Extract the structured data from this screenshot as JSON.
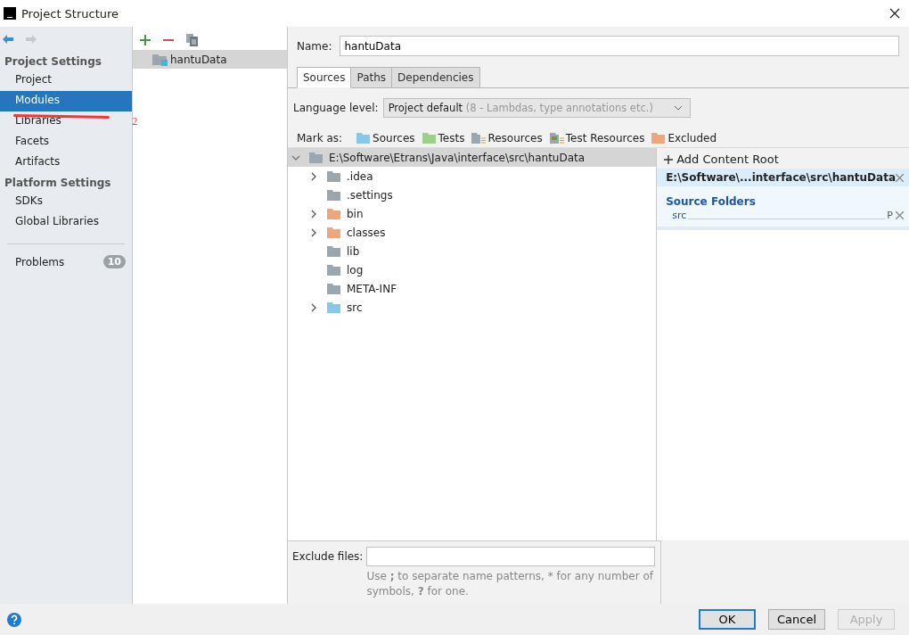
{
  "window": {
    "title": "Project Structure"
  },
  "sidebar": {
    "sections": [
      {
        "title": "Project Settings",
        "items": [
          {
            "label": "Project",
            "selected": false
          },
          {
            "label": "Modules",
            "selected": true
          },
          {
            "label": "Libraries",
            "selected": false
          },
          {
            "label": "Facets",
            "selected": false
          },
          {
            "label": "Artifacts",
            "selected": false
          }
        ]
      },
      {
        "title": "Platform Settings",
        "items": [
          {
            "label": "SDKs",
            "selected": false
          },
          {
            "label": "Global Libraries",
            "selected": false
          }
        ]
      }
    ],
    "problems": {
      "label": "Problems",
      "count": "10"
    }
  },
  "annotation": {
    "mark": "2"
  },
  "modules": [
    {
      "name": "hantuData",
      "selected": true
    }
  ],
  "name_field": {
    "label": "Name:",
    "value": "hantuData"
  },
  "tabs": [
    {
      "label": "Sources",
      "selected": true
    },
    {
      "label": "Paths",
      "selected": false
    },
    {
      "label": "Dependencies",
      "selected": false
    }
  ],
  "language_level": {
    "label": "Language level:",
    "value": "Project default",
    "hint": "(8 - Lambdas, type annotations etc.)"
  },
  "mark_as": {
    "label": "Mark as:",
    "options": [
      {
        "label": "Sources",
        "kind": "sources"
      },
      {
        "label": "Tests",
        "kind": "tests"
      },
      {
        "label": "Resources",
        "kind": "resources"
      },
      {
        "label": "Test Resources",
        "kind": "test-resources"
      },
      {
        "label": "Excluded",
        "kind": "excluded"
      }
    ]
  },
  "tree": [
    {
      "name": "E:\\Software\\Etrans\\Java\\interface\\src\\hantuData",
      "expanded": true,
      "kind": "plain",
      "selected": true,
      "children": [
        {
          "name": ".idea",
          "expanded": false,
          "kind": "plain",
          "selected": false
        },
        {
          "name": ".settings",
          "kind": "plain",
          "selected": false
        },
        {
          "name": "bin",
          "expanded": false,
          "kind": "excluded",
          "selected": false
        },
        {
          "name": "classes",
          "expanded": false,
          "kind": "excluded",
          "selected": false
        },
        {
          "name": "lib",
          "kind": "plain",
          "selected": false
        },
        {
          "name": "log",
          "kind": "plain",
          "selected": false
        },
        {
          "name": "META-INF",
          "kind": "plain",
          "selected": false
        },
        {
          "name": "src",
          "expanded": false,
          "kind": "sources",
          "selected": false
        }
      ]
    }
  ],
  "content_root": {
    "add_label": "Add Content Root",
    "path": "E:\\Software\\...interface\\src\\hantuData",
    "section_title": "Source Folders",
    "folders": [
      {
        "name": "src",
        "prefix_button": "P"
      }
    ]
  },
  "exclude_files": {
    "label": "Exclude files:",
    "hint": "Use **;** to separate name patterns, * for any number of symbols, **?** for one."
  },
  "buttons": [
    {
      "label": "OK",
      "kind": "default"
    },
    {
      "label": "Cancel",
      "kind": "normal"
    },
    {
      "label": "Apply",
      "kind": "disabled"
    }
  ]
}
